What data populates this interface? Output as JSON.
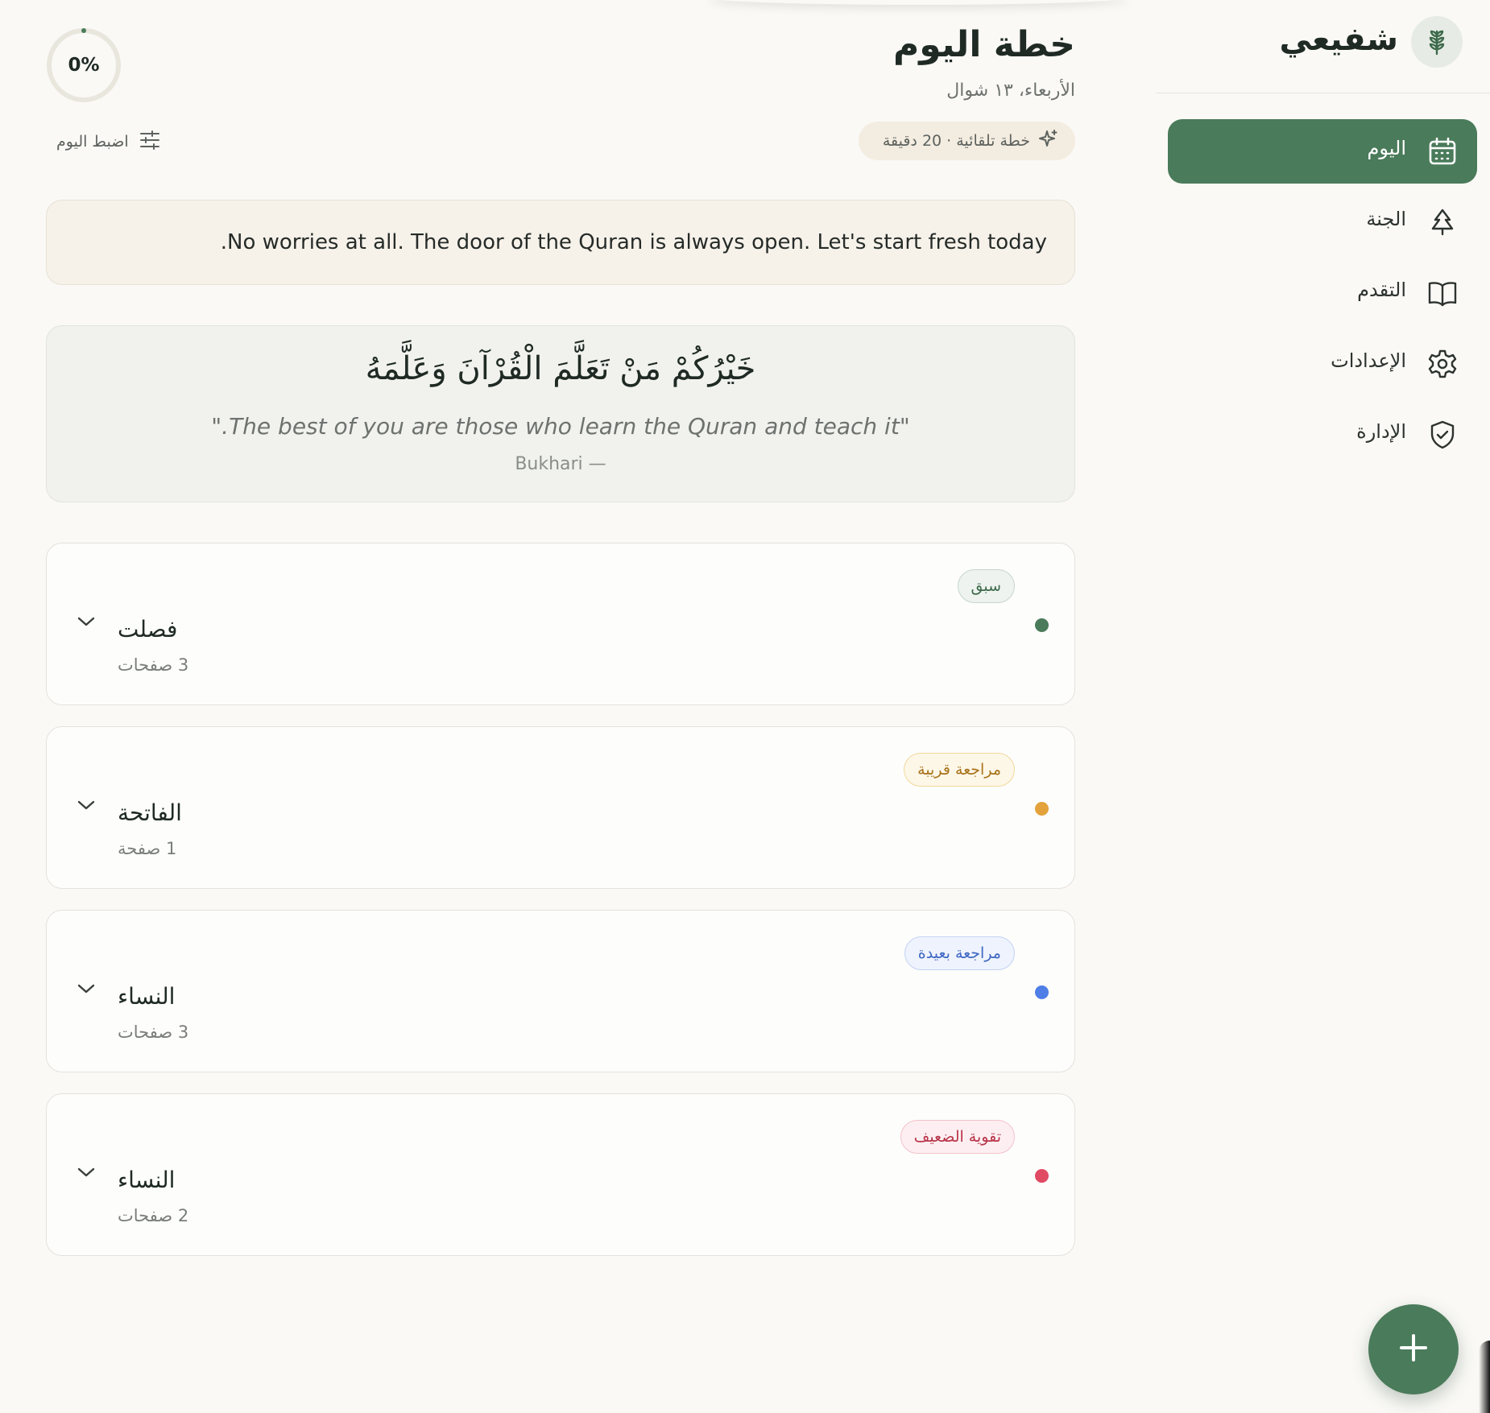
{
  "brand": {
    "name": "شفيعي",
    "logo_icon": "leaf-icon"
  },
  "sidebar": {
    "items": [
      {
        "label": "اليوم",
        "icon": "calendar-icon",
        "active": true
      },
      {
        "label": "الجنة",
        "icon": "tree-icon",
        "active": false
      },
      {
        "label": "التقدم",
        "icon": "book-open-icon",
        "active": false
      },
      {
        "label": "الإعدادات",
        "icon": "gear-icon",
        "active": false
      },
      {
        "label": "الإدارة",
        "icon": "shield-check-icon",
        "active": false
      }
    ]
  },
  "header": {
    "title": "خطة اليوم",
    "date": "الأربعاء، ١٣ شوال",
    "plan_chip": "خطة تلقائية · 20 دقيقة",
    "progress": {
      "value": 0,
      "label": "0%"
    },
    "adjust_label": "اضبط اليوم"
  },
  "notice": {
    "text": ".No worries at all. The door of the Quran is always open. Let's start fresh today"
  },
  "quote": {
    "arabic": "خَيْرُكُمْ مَنْ تَعَلَّمَ الْقُرْآنَ وَعَلَّمَهُ",
    "english": "\".The best of you are those who learn the Quran and teach it\"",
    "source": "Bukhari —"
  },
  "tasks": [
    {
      "badge": "سبق",
      "surah": "فصلت",
      "pages": "3 صفحات",
      "color": "#4a7b5a"
    },
    {
      "badge": "مراجعة قريبة",
      "surah": "الفاتحة",
      "pages": "1 صفحة",
      "color": "#e3a23b"
    },
    {
      "badge": "مراجعة بعيدة",
      "surah": "النساء",
      "pages": "3 صفحات",
      "color": "#4f7fe6"
    },
    {
      "badge": "تقوية الضعيف",
      "surah": "النساء",
      "pages": "2 صفحات",
      "color": "#e04a62"
    }
  ],
  "colors": {
    "accent": "#4a7b5a",
    "background": "#faf9f6"
  },
  "fab": {
    "icon": "plus-icon"
  }
}
